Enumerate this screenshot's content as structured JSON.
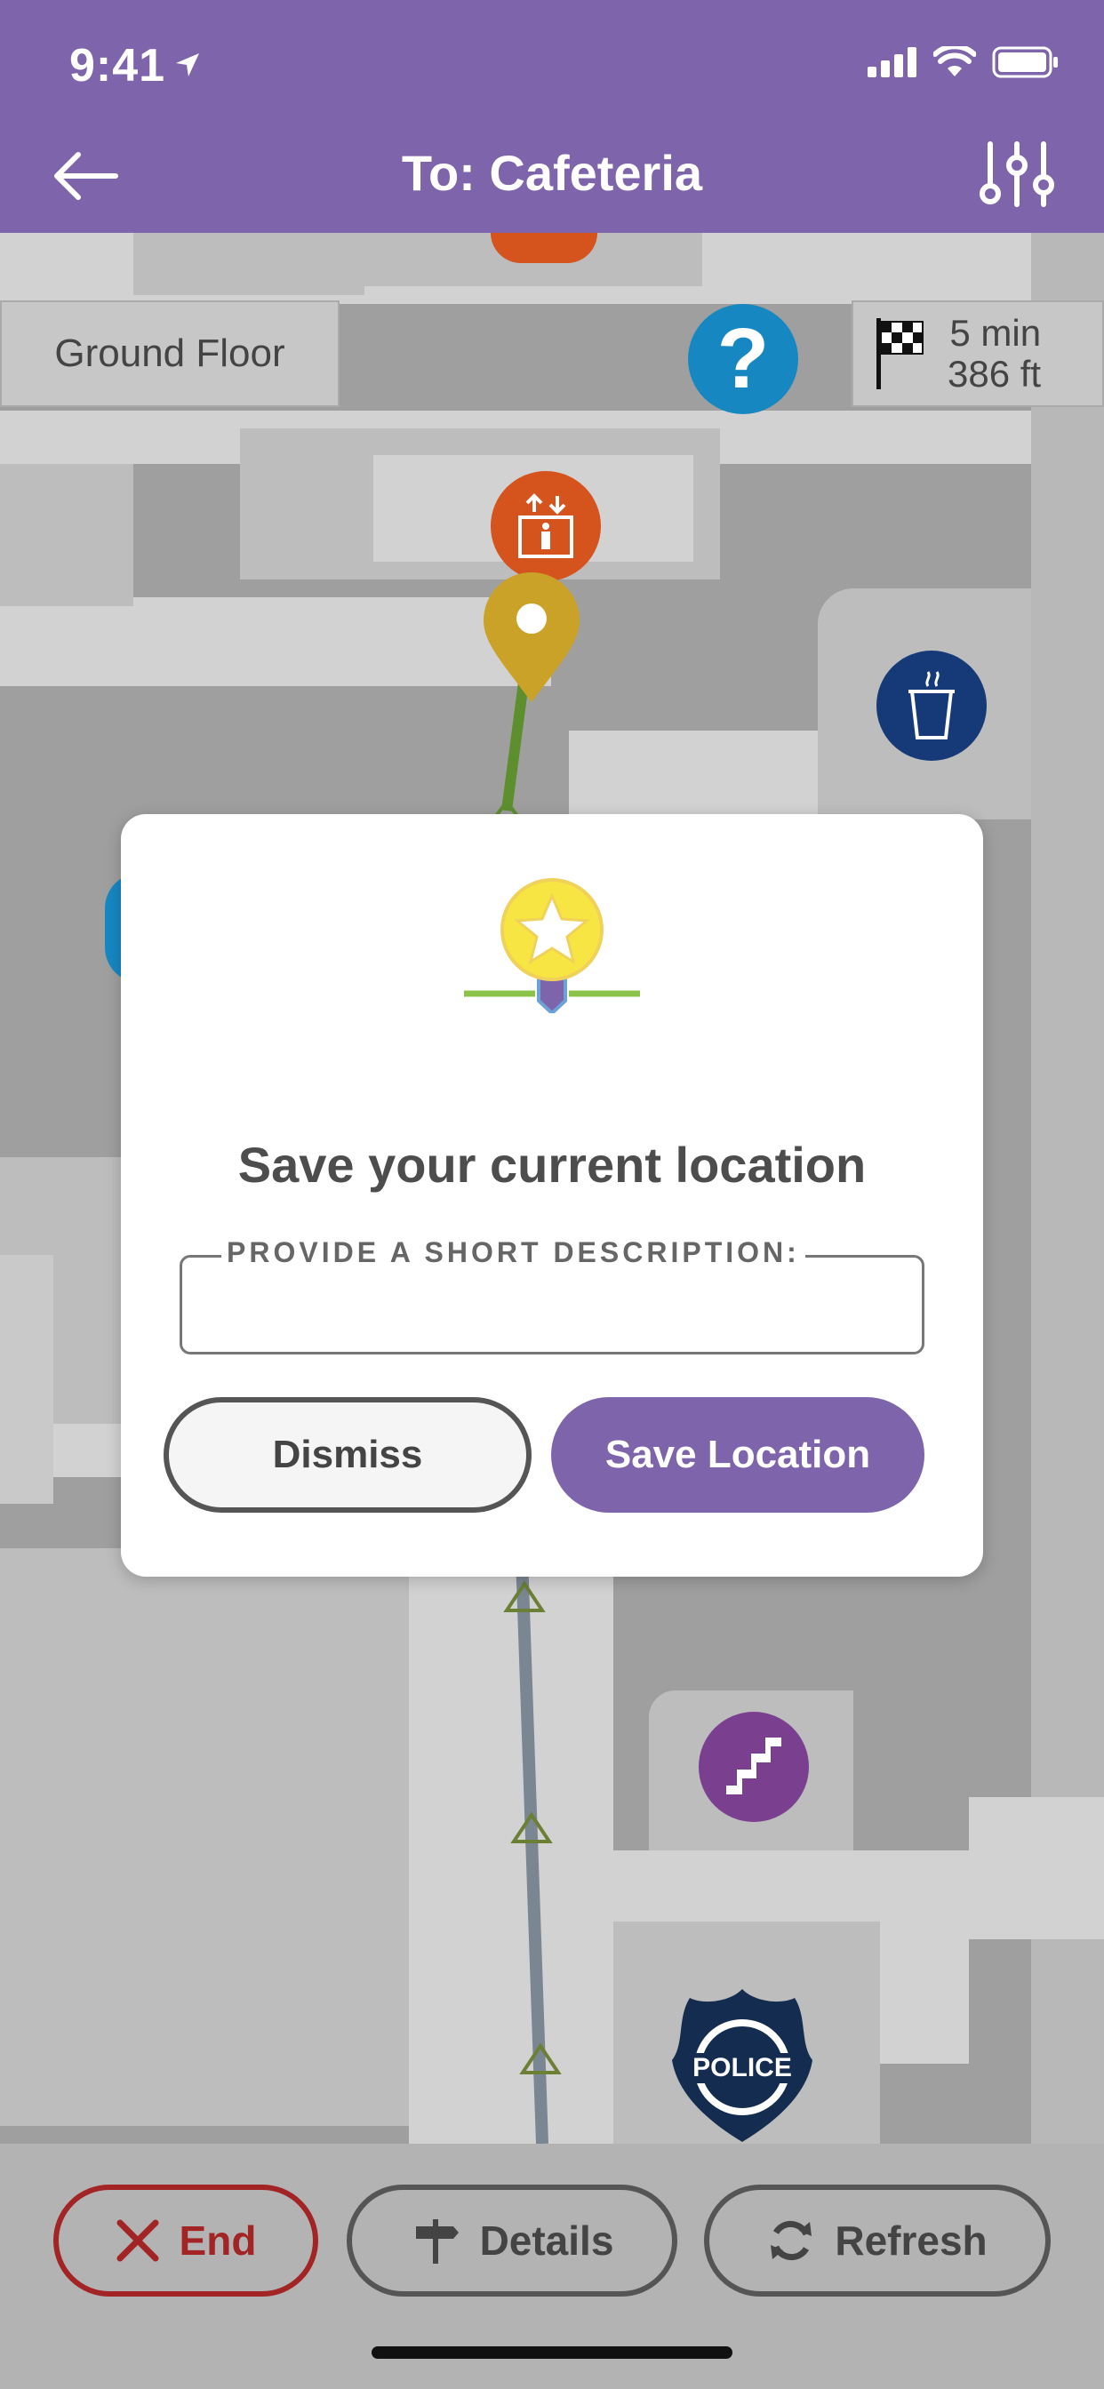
{
  "status_bar": {
    "time": "9:41"
  },
  "header": {
    "title": "To: Cafeteria"
  },
  "map": {
    "floor_label": "Ground Floor",
    "eta_time": "5 min",
    "eta_distance": "386 ft",
    "police_label": "POLICE"
  },
  "dialog": {
    "title": "Save your current location",
    "field_label": "PROVIDE A SHORT DESCRIPTION:",
    "field_value": "",
    "dismiss_label": "Dismiss",
    "save_label": "Save Location"
  },
  "bottom_bar": {
    "end_label": "End",
    "details_label": "Details",
    "refresh_label": "Refresh"
  },
  "colors": {
    "brand_purple": "#7e65ab",
    "end_red": "#a32424",
    "route_green": "#5e8f2f",
    "pin_gold": "#c9a227"
  }
}
